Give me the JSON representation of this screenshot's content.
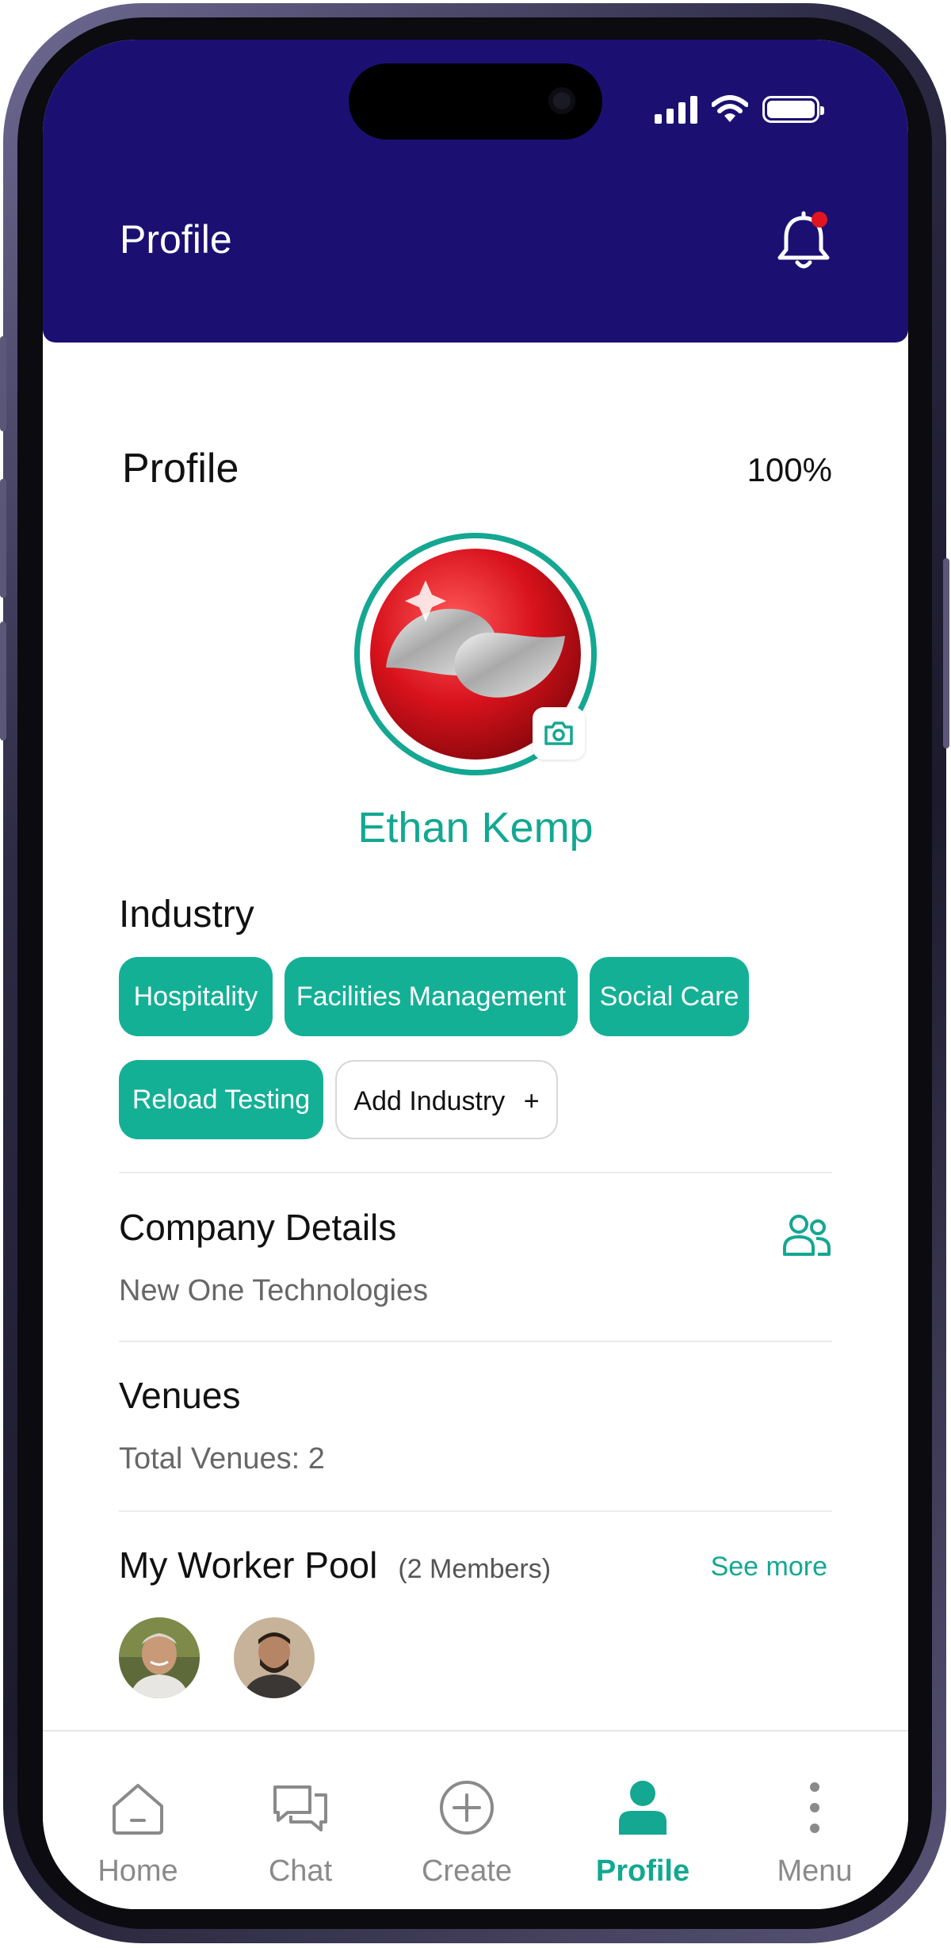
{
  "header": {
    "title": "Profile"
  },
  "profile": {
    "section_title": "Profile",
    "completion": "100%",
    "user_name": "Ethan Kemp"
  },
  "industry": {
    "title": "Industry",
    "chips": [
      "Hospitality",
      "Facilities Management",
      "Social Care",
      "Reload Testing"
    ],
    "add_label": "Add Industry",
    "add_symbol": "+"
  },
  "company": {
    "title": "Company Details",
    "name": "New One Technologies"
  },
  "venues": {
    "title": "Venues",
    "total": "Total Venues: 2"
  },
  "worker_pool": {
    "title": "My Worker Pool",
    "members": "(2 Members)",
    "see_more": "See more"
  },
  "nav": {
    "items": [
      "Home",
      "Chat",
      "Create",
      "Profile",
      "Menu"
    ],
    "active": "Profile"
  },
  "colors": {
    "header_bg": "#1b1072",
    "accent": "#14a792",
    "notification": "#e0151f"
  },
  "icons": {
    "notification": "bell-icon",
    "company": "users-group-icon",
    "camera": "camera-icon"
  }
}
